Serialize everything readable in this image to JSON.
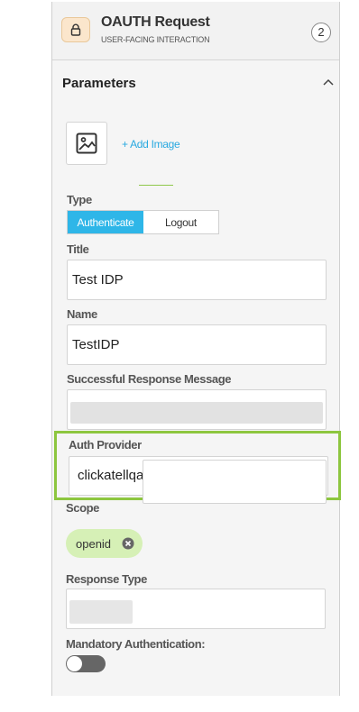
{
  "header": {
    "icon": "lock-icon",
    "title": "OAUTH Request",
    "subtitle": "USER-FACING INTERACTION",
    "count": "2"
  },
  "parameters": {
    "section_title": "Parameters",
    "collapse_icon": "chevron-up-icon",
    "image_icon": "image-icon",
    "add_image_label": "+ Add Image"
  },
  "type": {
    "label": "Type",
    "options": [
      "Authenticate",
      "Logout"
    ],
    "selected": "Authenticate"
  },
  "title_field": {
    "label": "Title",
    "value": "Test IDP"
  },
  "name_field": {
    "label": "Name",
    "value": "TestIDP"
  },
  "success_message": {
    "label": "Successful Response Message",
    "value": ""
  },
  "auth_provider": {
    "label": "Auth Provider",
    "value": "clickatellqat2020",
    "dropdown_icon": "chevron-down-icon"
  },
  "scope": {
    "label": "Scope",
    "tags": [
      {
        "label": "openid",
        "remove_icon": "close-circle-icon"
      }
    ]
  },
  "response_type": {
    "label": "Response Type",
    "value": ""
  },
  "mandatory_auth": {
    "label": "Mandatory Authentication:",
    "enabled": false
  },
  "colors": {
    "accent_blue": "#2eb6e8",
    "link_blue": "#29a9e0",
    "highlight_green": "#8dc63f",
    "chip_green": "#d6f0b6",
    "lock_bg": "#fbe6cc"
  }
}
